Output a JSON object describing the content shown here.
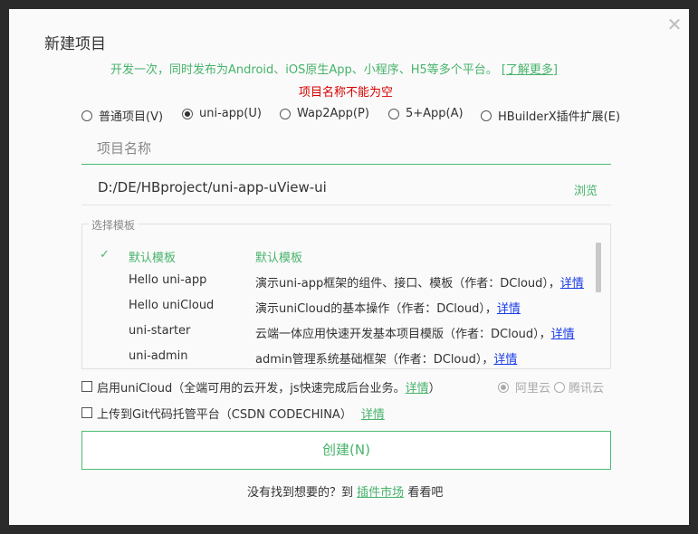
{
  "dialog": {
    "title": "新建项目",
    "subtitle": "开发一次，同时发布为Android、iOS原生App、小程序、H5等多个平台。",
    "learn_more": "[了解更多]",
    "error": "项目名称不能为空",
    "close_icon": "close-icon"
  },
  "project_types": [
    {
      "label": "普通项目(V)",
      "selected": false
    },
    {
      "label": "uni-app(U)",
      "selected": true
    },
    {
      "label": "Wap2App(P)",
      "selected": false
    },
    {
      "label": "5+App(A)",
      "selected": false
    },
    {
      "label": "HBuilderX插件扩展(E)",
      "selected": false
    }
  ],
  "project_name": {
    "placeholder": "项目名称",
    "value": ""
  },
  "location": {
    "path": "D:/DE/HBproject/uni-app-uView-ui",
    "browse": "浏览"
  },
  "templates": {
    "legend": "选择模板",
    "rows": [
      {
        "name": "默认模板",
        "desc": "默认模板",
        "detail": "",
        "selected": true
      },
      {
        "name": "Hello uni-app",
        "desc": "演示uni-app框架的组件、接口、模板（作者：DCloud），",
        "detail": "详情",
        "selected": false
      },
      {
        "name": "Hello uniCloud",
        "desc": "演示uniCloud的基本操作（作者：DCloud），",
        "detail": "详情",
        "selected": false
      },
      {
        "name": "uni-starter",
        "desc": "云端一体应用快速开发基本项目模版（作者：DCloud），",
        "detail": "详情",
        "selected": false
      },
      {
        "name": "uni-admin",
        "desc": "admin管理系统基础框架（作者：DCloud），",
        "detail": "详情",
        "selected": false
      }
    ]
  },
  "unicloud": {
    "label": "启用uniCloud（全端可用的云开发，js快速完成后台业务。",
    "detail": "详情",
    "close_paren": "）",
    "checked": false,
    "providers": [
      {
        "label": "阿里云",
        "selected": true
      },
      {
        "label": "腾讯云",
        "selected": false
      }
    ]
  },
  "git": {
    "label": "上传到Git代码托管平台（CSDN CODECHINA）",
    "detail": "详情",
    "checked": false
  },
  "create_button": "创建(N)",
  "footer": {
    "prefix": "没有找到想要的？到",
    "market": "插件市场",
    "suffix": "看看吧"
  },
  "colors": {
    "accent": "#47b36b",
    "error": "#d80000",
    "link": "#1a3ce8"
  }
}
